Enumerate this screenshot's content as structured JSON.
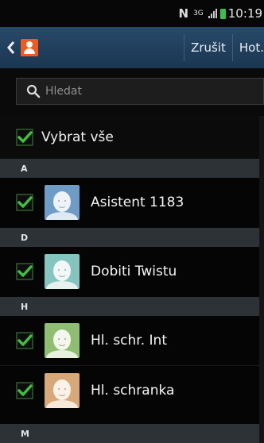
{
  "status_bar": {
    "time": "10:19",
    "n_icon": "N",
    "network_icon": "3G",
    "signal_icon": "signal-icon",
    "battery_icon": "battery-icon"
  },
  "action_bar": {
    "back_icon": "chevron-left-icon",
    "app_icon": "contact-icon",
    "cancel_label": "Zrušit",
    "done_label": "Hot."
  },
  "search": {
    "placeholder": "Hledat",
    "icon": "search-icon"
  },
  "select_all": {
    "label": "Vybrat vše",
    "checked": true
  },
  "sections": [
    {
      "letter": "A"
    },
    {
      "letter": "D"
    },
    {
      "letter": "H"
    },
    {
      "letter": "M"
    }
  ],
  "contacts": [
    {
      "name": "Asistent 1183",
      "checked": true,
      "avatar_bg": "#6f9cc7"
    },
    {
      "name": "Dobiti Twistu",
      "checked": true,
      "avatar_bg": "#86c4bf"
    },
    {
      "name": "Hl. schr. Int",
      "checked": true,
      "avatar_bg": "#8fbe72"
    },
    {
      "name": "Hl. schranka",
      "checked": true,
      "avatar_bg": "#d8a978"
    }
  ],
  "colors": {
    "check_green": "#3fbf3f",
    "action_bar": "#1f3d5a",
    "section_bg": "#2d3237"
  }
}
